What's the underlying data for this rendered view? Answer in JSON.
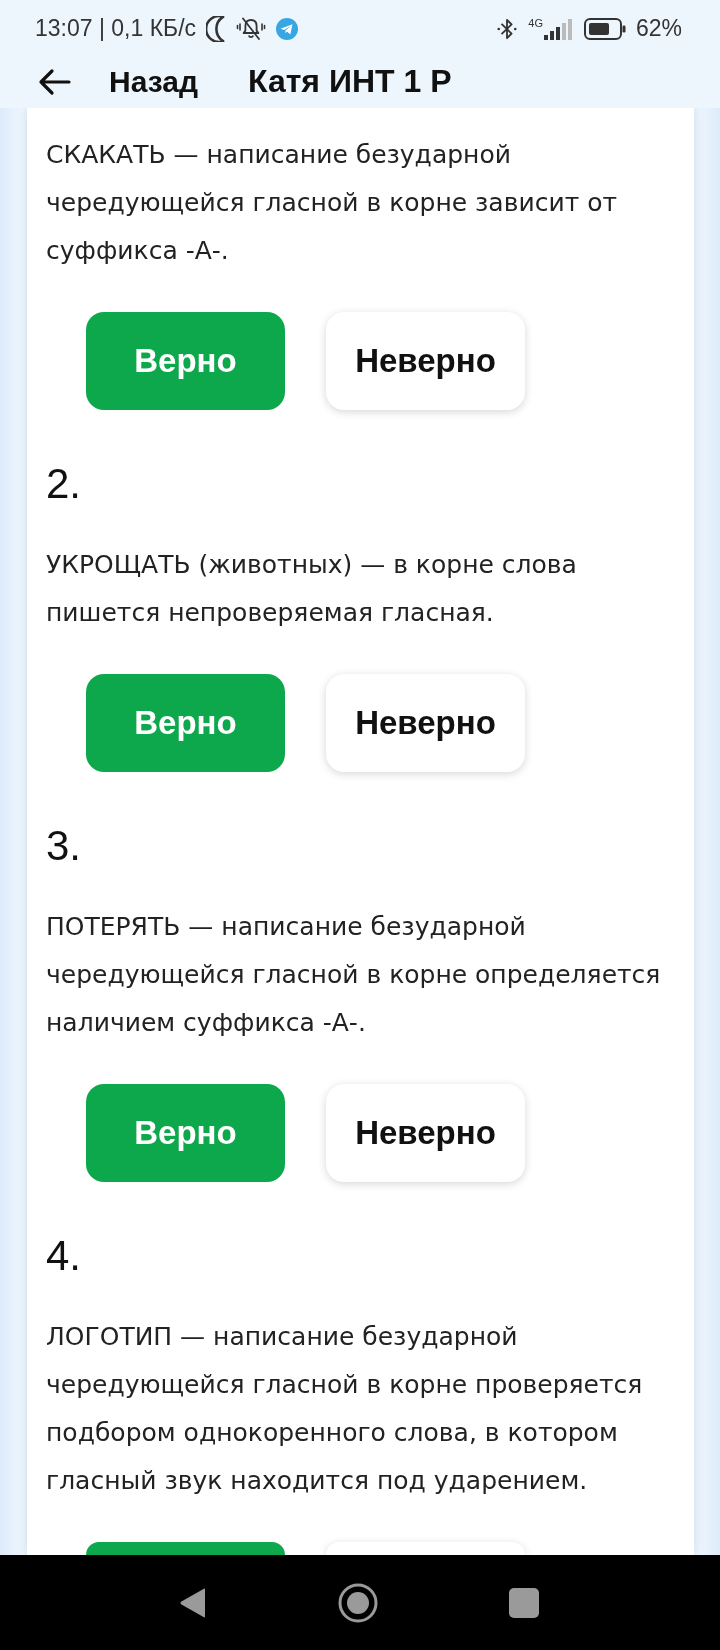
{
  "status_bar": {
    "time_speed": "13:07 | 0,1 КБ/с",
    "network": "4G",
    "battery": "62%"
  },
  "header": {
    "back_label": "Назад",
    "title": "Катя ИНТ 1 Р"
  },
  "questions": [
    {
      "text": "СКАКАТЬ — написание безударной чередующейся гласной в корне зависит от суффикса -А-.",
      "answers": [
        {
          "kind": "correct",
          "label": "Верно"
        },
        {
          "kind": "incorrect",
          "label": "Неверно"
        }
      ]
    },
    {
      "number": "2.",
      "text": "УКРОЩАТЬ (животных) — в корне слова пишется непроверяемая гласная.",
      "answers": [
        {
          "kind": "correct",
          "label": "Верно"
        },
        {
          "kind": "incorrect",
          "label": "Неверно"
        }
      ]
    },
    {
      "number": "3.",
      "text": "ПОТЕРЯТЬ — написание безударной чередующейся гласной в корне определяется наличием суффикса -А-.",
      "answers": [
        {
          "kind": "correct",
          "label": "Верно"
        },
        {
          "kind": "incorrect",
          "label": "Неверно"
        }
      ]
    },
    {
      "number": "4.",
      "text": "ЛОГОТИП — написание безударной чередующейся гласной в корне проверяется подбором однокоренного слова, в котором гласный звук находится под ударением.",
      "answers": [
        {
          "kind": "correct"
        },
        {
          "kind": "incorrect"
        }
      ]
    }
  ]
}
